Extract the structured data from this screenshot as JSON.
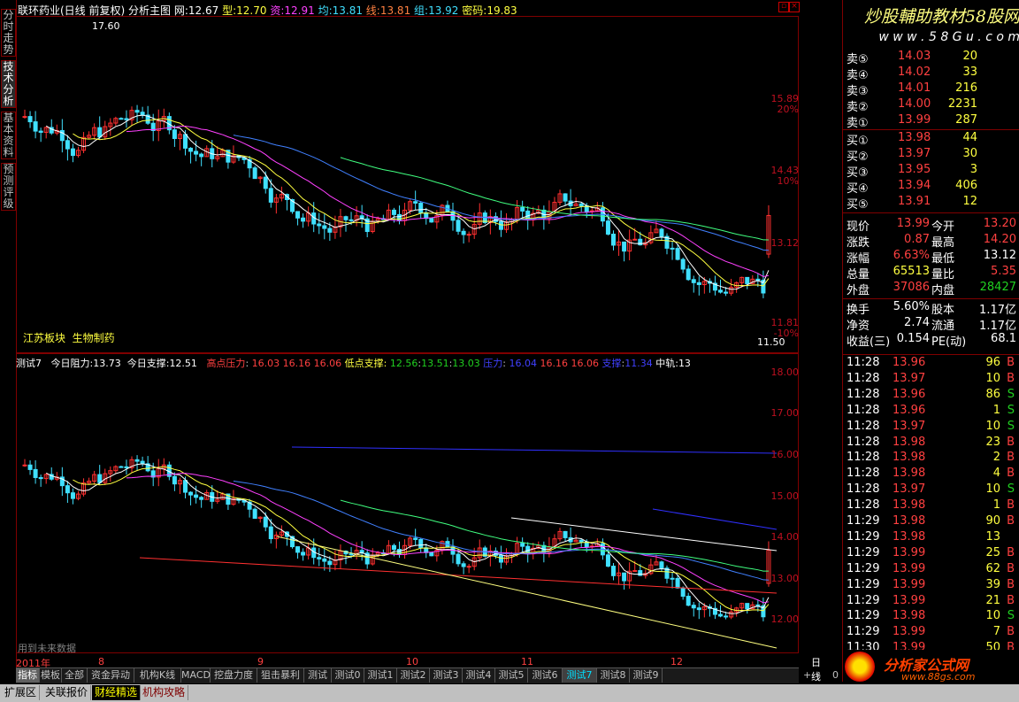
{
  "left_tabs": [
    "分时走势",
    "技术分析",
    "基本资料",
    "预测评级"
  ],
  "header": {
    "stock_name": "联环药业(日线 前复权)",
    "main_chart_label": "分析主图",
    "ind": [
      {
        "label": "网:",
        "value": "12.67",
        "color": "#ffffff"
      },
      {
        "label": "型:",
        "value": "12.70",
        "color": "#ffff40"
      },
      {
        "label": "资:",
        "value": "12.91",
        "color": "#ff40ff"
      },
      {
        "label": "均:",
        "value": "13.81",
        "color": "#40e0ff"
      },
      {
        "label": "线:",
        "value": "13.81",
        "color": "#ff8040"
      },
      {
        "label": "组:",
        "value": "13.92",
        "color": "#40e0ff"
      },
      {
        "label": "密码:",
        "value": "19.83",
        "color": "#ffff40"
      }
    ],
    "watermark": "炒股輔助教材58股网",
    "watermark_url": "w w w . 5 8 G u . c o m"
  },
  "main_chart": {
    "price_labels": [
      "15.89",
      "20%",
      "14.43",
      "10%",
      "13.12",
      "11.81",
      "-10%"
    ],
    "high_mark": "17.60",
    "low_mark": "11.50",
    "sector_label": "江苏板块",
    "industry_label": "生物制药"
  },
  "sub_chart": {
    "indicator_name": "测试7",
    "resistance_label": "今日阻力:",
    "resistance_value": "13.73",
    "support_label": "今日支撑:",
    "support_value": "12.51",
    "high_pressure_label": "高点压力",
    "high_pressure_values": [
      "16.03",
      "16.16",
      "16.06"
    ],
    "low_support_label": "低点支撑:",
    "low_support_values": [
      "12.56",
      "13.51",
      "13.03"
    ],
    "blue_label_1": "压力",
    "blue_values_1": [
      "16.04",
      "16.16",
      "16.06"
    ],
    "blue_label_2": "支撑",
    "blue_value_2": "11.34",
    "mid_label": "中轨:",
    "mid_value": "13",
    "price_labels": [
      "18.00",
      "17.00",
      "16.00",
      "15.00",
      "14.00",
      "13.00",
      "12.00"
    ],
    "footer_note": "用到未来数据"
  },
  "time_axis": {
    "labels": [
      "2011年",
      "8",
      "9",
      "10",
      "11",
      "12"
    ],
    "period": "日线"
  },
  "quote": {
    "asks": [
      {
        "label": "卖⑤",
        "price": "14.03",
        "vol": "20"
      },
      {
        "label": "卖④",
        "price": "14.02",
        "vol": "33"
      },
      {
        "label": "卖③",
        "price": "14.01",
        "vol": "216"
      },
      {
        "label": "卖②",
        "price": "14.00",
        "vol": "2231"
      },
      {
        "label": "卖①",
        "price": "13.99",
        "vol": "287"
      }
    ],
    "bids": [
      {
        "label": "买①",
        "price": "13.98",
        "vol": "44"
      },
      {
        "label": "买②",
        "price": "13.97",
        "vol": "30"
      },
      {
        "label": "买③",
        "price": "13.95",
        "vol": "3"
      },
      {
        "label": "买④",
        "price": "13.94",
        "vol": "406"
      },
      {
        "label": "买⑤",
        "price": "13.91",
        "vol": "12"
      }
    ],
    "stats": [
      {
        "l1": "现价",
        "v1": "13.99",
        "c1": "#ff4040",
        "l2": "今开",
        "v2": "13.20",
        "c2": "#ff4040"
      },
      {
        "l1": "涨跌",
        "v1": "0.87",
        "c1": "#ff4040",
        "l2": "最高",
        "v2": "14.20",
        "c2": "#ff4040"
      },
      {
        "l1": "涨幅",
        "v1": "6.63%",
        "c1": "#ff4040",
        "l2": "最低",
        "v2": "13.12",
        "c2": "#ffffff"
      },
      {
        "l1": "总量",
        "v1": "65513",
        "c1": "#ffff40",
        "l2": "量比",
        "v2": "5.35",
        "c2": "#ff4040"
      },
      {
        "l1": "外盘",
        "v1": "37086",
        "c1": "#ff4040",
        "l2": "内盘",
        "v2": "28427",
        "c2": "#20d020"
      },
      {
        "l1": "换手",
        "v1": "5.60%",
        "c1": "#ffffff",
        "l2": "股本",
        "v2": "1.17亿",
        "c2": "#ffffff"
      },
      {
        "l1": "净资",
        "v1": "2.74",
        "c1": "#ffffff",
        "l2": "流通",
        "v2": "1.17亿",
        "c2": "#ffffff"
      },
      {
        "l1": "收益(三)",
        "v1": "0.154",
        "c1": "#ffffff",
        "l2": "PE(动)",
        "v2": "68.1",
        "c2": "#ffffff"
      }
    ]
  },
  "ticks": [
    {
      "time": "11:28",
      "price": "13.96",
      "vol": "96",
      "side": "B"
    },
    {
      "time": "11:28",
      "price": "13.97",
      "vol": "10",
      "side": "B"
    },
    {
      "time": "11:28",
      "price": "13.96",
      "vol": "86",
      "side": "S"
    },
    {
      "time": "11:28",
      "price": "13.96",
      "vol": "1",
      "side": "S"
    },
    {
      "time": "11:28",
      "price": "13.97",
      "vol": "10",
      "side": "S"
    },
    {
      "time": "11:28",
      "price": "13.98",
      "vol": "23",
      "side": "B"
    },
    {
      "time": "11:28",
      "price": "13.98",
      "vol": "2",
      "side": "B"
    },
    {
      "time": "11:28",
      "price": "13.98",
      "vol": "4",
      "side": "B"
    },
    {
      "time": "11:28",
      "price": "13.97",
      "vol": "10",
      "side": "S"
    },
    {
      "time": "11:28",
      "price": "13.98",
      "vol": "1",
      "side": "B"
    },
    {
      "time": "11:29",
      "price": "13.98",
      "vol": "90",
      "side": "B"
    },
    {
      "time": "11:29",
      "price": "13.98",
      "vol": "13",
      "side": ""
    },
    {
      "time": "11:29",
      "price": "13.99",
      "vol": "25",
      "side": "B"
    },
    {
      "time": "11:29",
      "price": "13.99",
      "vol": "62",
      "side": "B"
    },
    {
      "time": "11:29",
      "price": "13.99",
      "vol": "39",
      "side": "B"
    },
    {
      "time": "11:29",
      "price": "13.99",
      "vol": "21",
      "side": "B"
    },
    {
      "time": "11:29",
      "price": "13.98",
      "vol": "10",
      "side": "S"
    },
    {
      "time": "11:29",
      "price": "13.99",
      "vol": "7",
      "side": "B"
    },
    {
      "time": "11:30",
      "price": "13.99",
      "vol": "50",
      "side": "B"
    }
  ],
  "bottom_tabs": [
    "指标",
    "模板",
    "全部",
    "资金异动",
    "机构K线",
    "MACD",
    "挖盘力度",
    "狙击暴利",
    "测试",
    "测试0",
    "测试1",
    "测试2",
    "测试3",
    "测试4",
    "测试5",
    "测试6",
    "测试7",
    "测试8",
    "测试9"
  ],
  "status_tabs": [
    "扩展区",
    "关联报价",
    "财经精选",
    "机构攻略"
  ],
  "footer_brand": "分析家公式网",
  "footer_url": "www.88gs.com",
  "window_controls": [
    "+",
    "-",
    "0"
  ]
}
